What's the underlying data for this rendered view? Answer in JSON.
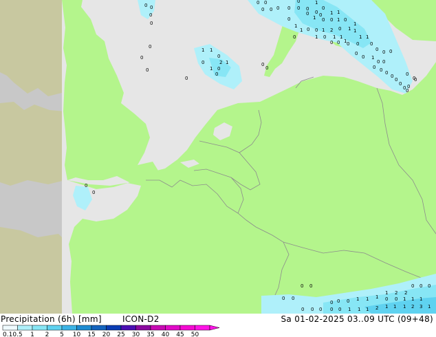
{
  "header": {
    "title": "Precipitation (6h) [mm]",
    "model": "ICON-D2",
    "valid_time": "Sa 01-02-2025 03..09 UTC (09+48)"
  },
  "legend": {
    "tick_labels": [
      "0.1",
      "0.5",
      "1",
      "2",
      "5",
      "10",
      "15",
      "20",
      "25",
      "30",
      "35",
      "40",
      "45",
      "50"
    ],
    "colors": [
      "#f0fbff",
      "#aff0fa",
      "#87e6f5",
      "#5fd2f0",
      "#3cb4e6",
      "#1e8cd2",
      "#1464be",
      "#0a3cb4",
      "#4b0fb4",
      "#8c0aa0",
      "#c80ab4",
      "#e10ac8",
      "#f50ad2",
      "#ff14e6"
    ]
  },
  "map": {
    "colors": {
      "sea": "#e6e6e6",
      "land_in_domain": "#b4f58c",
      "land_outside": "#c8c8a0",
      "sea_outside": "#c8c8c8",
      "precip_light": "#aff0fa",
      "precip_mod": "#87e6f5",
      "border": "#8c8c8c"
    },
    "labels": [
      "0",
      "0",
      "0",
      "0",
      "0",
      "0",
      "0",
      "0",
      "1",
      "1",
      "0",
      "2",
      "1",
      "1",
      "0",
      "0",
      "0",
      "0",
      "0",
      "0",
      "0",
      "0",
      "0",
      "0",
      "0",
      "1",
      "0",
      "0",
      "0",
      "0",
      "0",
      "1",
      "1",
      "1",
      "0",
      "0",
      "1",
      "0",
      "1",
      "0",
      "1",
      "1",
      "0",
      "0",
      "1",
      "2",
      "0",
      "1",
      "1",
      "0",
      "1",
      "0",
      "1",
      "1",
      "1",
      "1",
      "1",
      "0",
      "0",
      "0",
      "0",
      "0",
      "0",
      "0",
      "0",
      "0",
      "1",
      "0",
      "0",
      "0",
      "0",
      "0",
      "0",
      "0",
      "0",
      "0",
      "0",
      "0",
      "0",
      "0",
      "0",
      "0",
      "0",
      "0",
      "0",
      "0",
      "0",
      "0",
      "0",
      "0",
      "0",
      "0",
      "0",
      "0",
      "0",
      "0",
      "0",
      "0",
      "1",
      "1",
      "1",
      "0",
      "0",
      "1",
      "1",
      "1",
      "1",
      "1",
      "1",
      "2",
      "1",
      "1",
      "1",
      "2",
      "3",
      "1",
      "1",
      "2",
      "2",
      "0",
      "0",
      "0",
      "0",
      "0"
    ]
  }
}
